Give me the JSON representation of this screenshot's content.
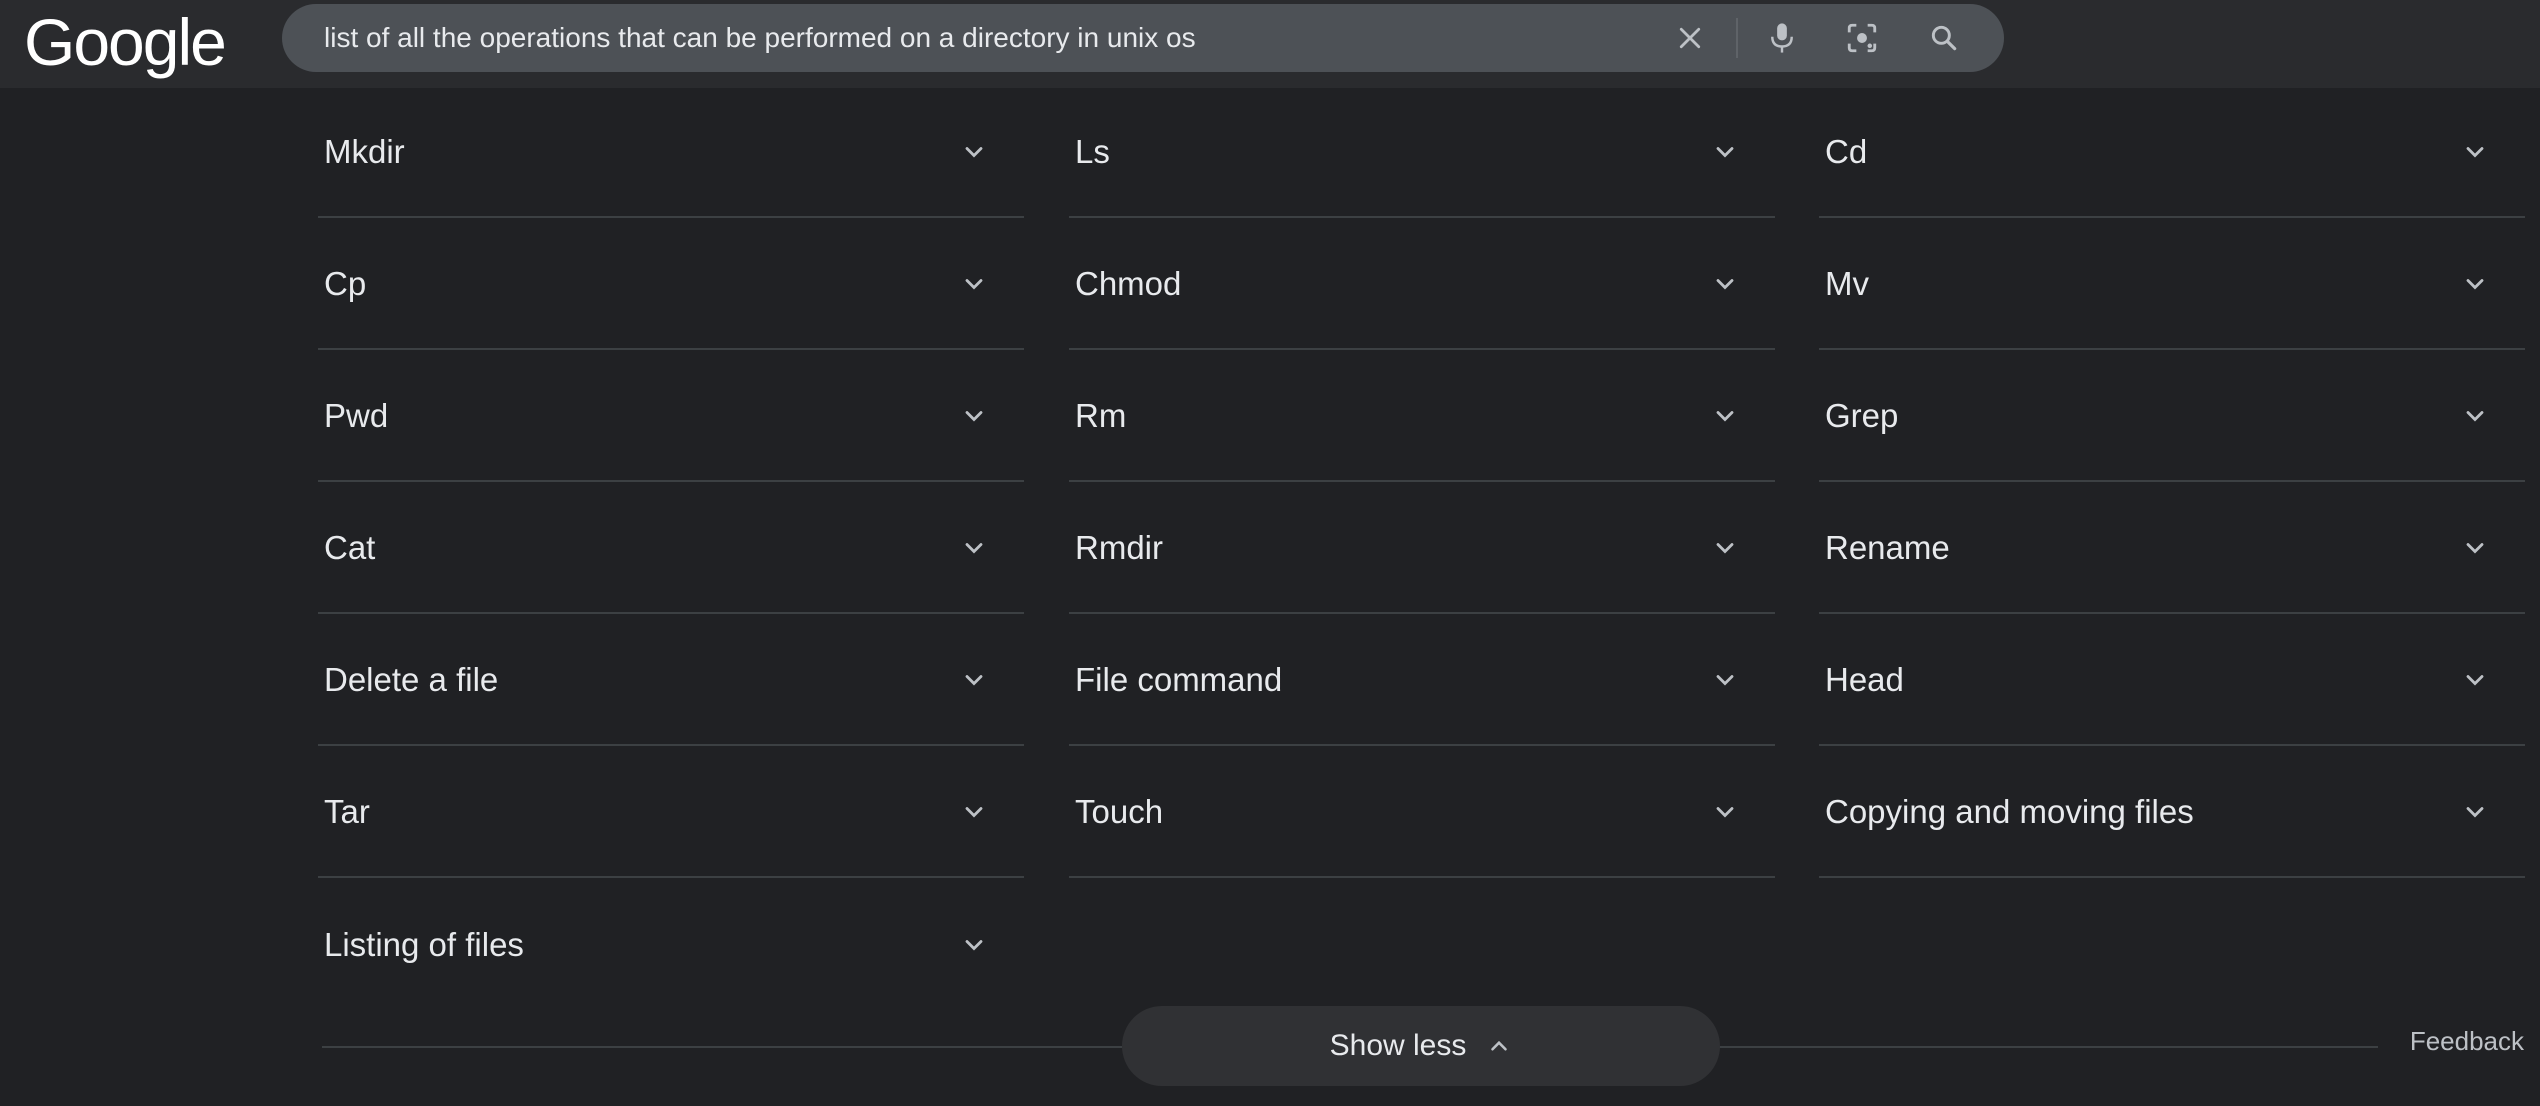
{
  "header": {
    "logo_text": "Google",
    "search_query": "list of all the operations that can be performed on a directory in unix os",
    "icons": [
      "close-icon",
      "microphone-icon",
      "lens-icon",
      "search-icon"
    ]
  },
  "items": [
    "Mkdir",
    "Ls",
    "Cd",
    "Cp",
    "Chmod",
    "Mv",
    "Pwd",
    "Rm",
    "Grep",
    "Cat",
    "Rmdir",
    "Rename",
    "Delete a file",
    "File command",
    "Head",
    "Tar",
    "Touch",
    "Copying and moving files",
    "Listing of files"
  ],
  "footer": {
    "show_less_label": "Show less",
    "feedback_label": "Feedback"
  },
  "colors": {
    "background": "#202124",
    "header": "#2a2b2e",
    "searchbar": "#4d5156",
    "divider": "#3c4043",
    "text": "#e8eaed",
    "icon": "#bdc1c6"
  }
}
